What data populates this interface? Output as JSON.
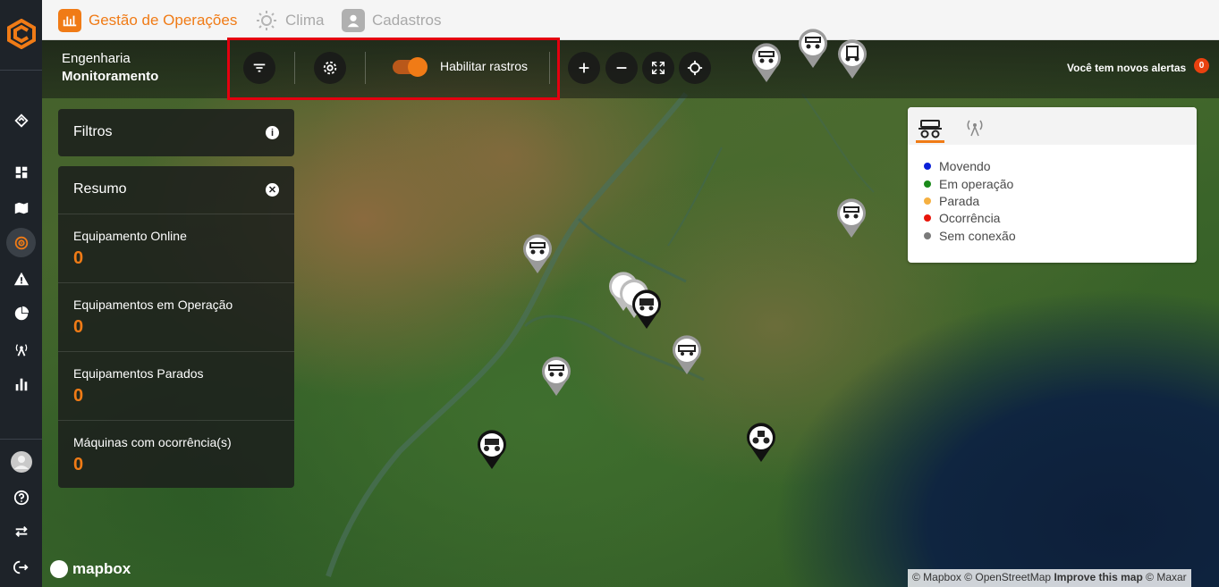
{
  "header": {
    "tabs": [
      {
        "label": "Gestão de Operações",
        "icon": "chart-icon",
        "active": true
      },
      {
        "label": "Clima",
        "icon": "sun-icon",
        "active": false
      },
      {
        "label": "Cadastros",
        "icon": "user-icon",
        "active": false
      }
    ]
  },
  "area": {
    "line1": "Engenharia",
    "line2": "Monitoramento"
  },
  "toolbar": {
    "track_toggle_label": "Habilitar rastros",
    "track_toggle_on": true
  },
  "alerts": {
    "label": "Você tem novos alertas",
    "count": "0"
  },
  "filters": {
    "title": "Filtros",
    "info_icon": "info-icon"
  },
  "summary": {
    "title": "Resumo",
    "stats": [
      {
        "label": "Equipamento Online",
        "value": "0"
      },
      {
        "label": "Equipamentos em Operação",
        "value": "0"
      },
      {
        "label": "Equipamentos Parados",
        "value": "0"
      },
      {
        "label": "Máquinas com ocorrência(s)",
        "value": "0"
      }
    ]
  },
  "legend": {
    "items": [
      {
        "label": "Movendo",
        "color": "#0a20d8"
      },
      {
        "label": "Em operação",
        "color": "#1a8a1a"
      },
      {
        "label": "Parada",
        "color": "#f5b041"
      },
      {
        "label": "Ocorrência",
        "color": "#e8150a"
      },
      {
        "label": "Sem conexão",
        "color": "#7a7a7a"
      }
    ]
  },
  "map": {
    "logo": "mapbox",
    "attribution": {
      "mapbox": "© Mapbox",
      "osm": "© OpenStreetMap",
      "improve": "Improve this map",
      "maxar": "© Maxar"
    }
  },
  "colors": {
    "accent": "#f07b16",
    "sidebar": "#1e2329",
    "highlight": "#e4000f"
  }
}
